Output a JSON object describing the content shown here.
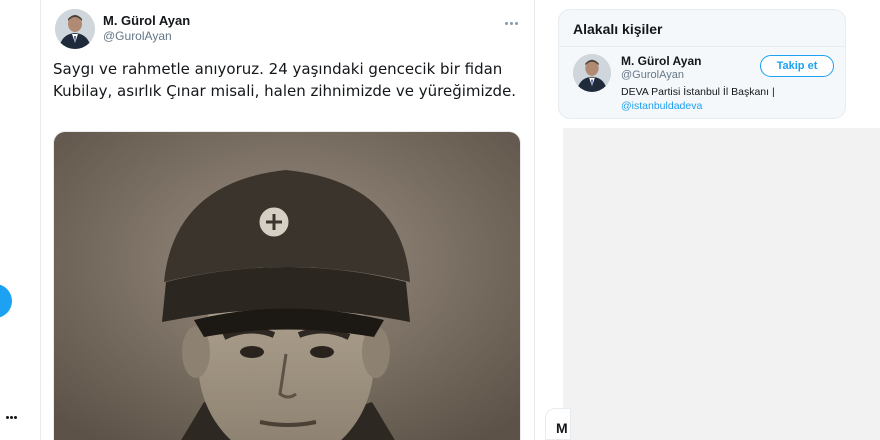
{
  "tweet": {
    "author_name": "M. Gürol Ayan",
    "author_handle": "@GurolAyan",
    "text": "Saygı ve rahmetle anıyoruz. 24 yaşındaki gencecik bir fidan Kubilay, asırlık Çınar misali, halen zihnimizde ve yüreğimizde.",
    "more_icon": "more-dots-icon"
  },
  "sidebar": {
    "title": "Alakalı kişiler",
    "person": {
      "name": "M. Gürol Ayan",
      "handle": "@GurolAyan",
      "bio": "DEVA Partisi İstanbul İl Başkanı |",
      "bio_link": "@istanbuldadeva",
      "follow_label": "Takip et"
    },
    "partial_label": "M"
  },
  "colors": {
    "accent": "#1da1f2",
    "text": "#14171a",
    "muted": "#657786",
    "border": "#e6ecf0"
  }
}
